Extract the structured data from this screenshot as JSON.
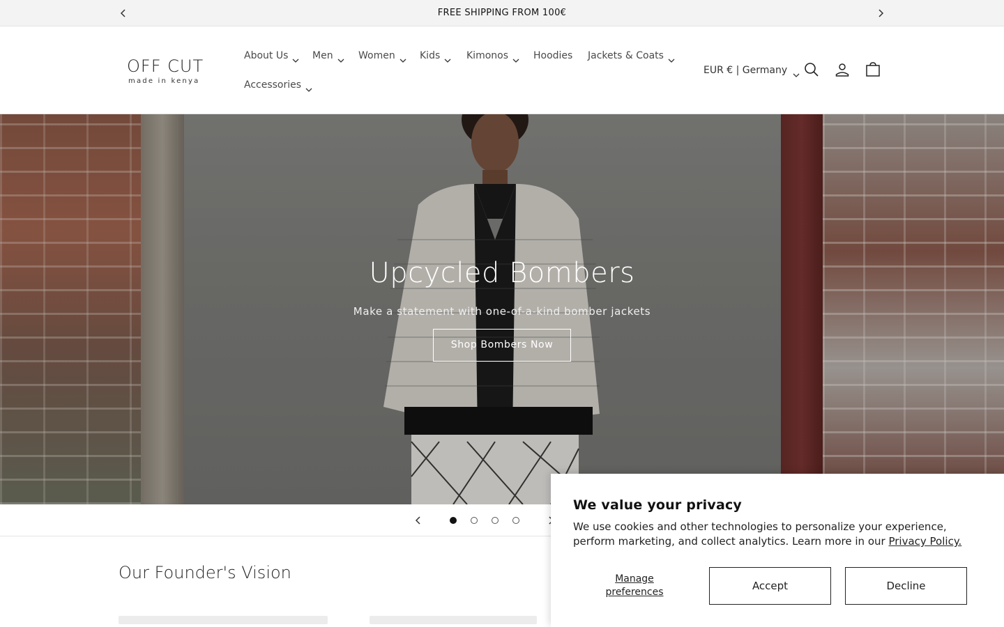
{
  "announcement": {
    "text": "FREE SHIPPING FROM 100€"
  },
  "header": {
    "logo_line1": "OFF CUT",
    "logo_line2": "made in kenya",
    "nav": [
      {
        "label": "About Us",
        "dropdown": true
      },
      {
        "label": "Men",
        "dropdown": true
      },
      {
        "label": "Women",
        "dropdown": true
      },
      {
        "label": "Kids",
        "dropdown": true
      },
      {
        "label": "Kimonos",
        "dropdown": true
      },
      {
        "label": "Hoodies",
        "dropdown": false
      },
      {
        "label": "Jackets & Coats",
        "dropdown": true
      },
      {
        "label": "Accessories",
        "dropdown": true
      }
    ],
    "locale": "EUR € | Germany",
    "icons": [
      "search-icon",
      "account-icon",
      "cart-icon"
    ]
  },
  "hero": {
    "title": "Upcycled Bombers",
    "subtitle": "Make a statement with one-of-a-kind bomber jackets",
    "button": "Shop Bombers Now",
    "slides": 4,
    "active_slide": 1
  },
  "founder": {
    "title": "Our Founder's Vision"
  },
  "cookie": {
    "title": "We value your privacy",
    "text": "We use cookies and other technologies to personalize your experience, perform marketing, and collect analytics. Learn more in our ",
    "link": "Privacy Policy.",
    "manage": "Manage preferences",
    "accept": "Accept",
    "decline": "Decline"
  },
  "colors": {
    "text": "#121212",
    "announcement_bg": "#f3f3f3",
    "white": "#ffffff"
  }
}
